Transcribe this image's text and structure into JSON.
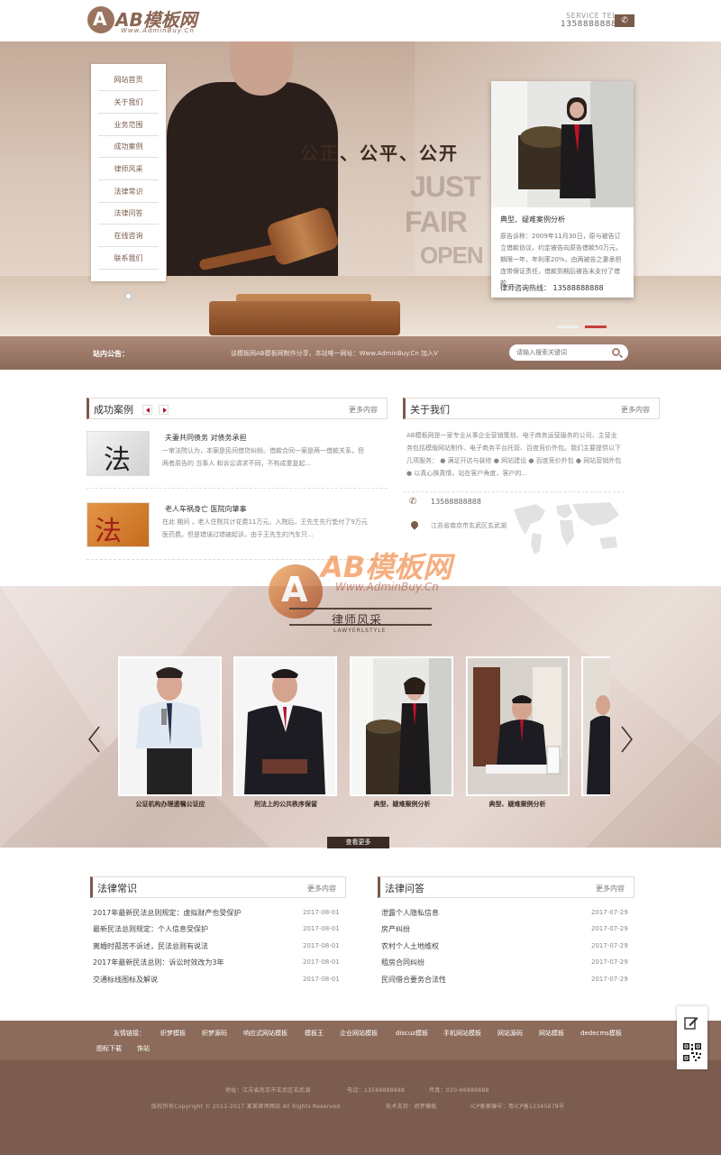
{
  "header": {
    "logo_text": "AB模板网",
    "logo_sub": "Www.AdminBuy.Cn",
    "service_label": "SERVICE TEL",
    "service_phone": "13588888888"
  },
  "nav": {
    "items": [
      "网站首页",
      "关于我们",
      "业务范围",
      "成功案例",
      "律师风采",
      "法律常识",
      "法律问答",
      "在线咨询",
      "联系我们"
    ]
  },
  "banner": {
    "slogan": "公正、公平、公开",
    "just": "JUST",
    "fair": "FAIR",
    "open": "OPEN",
    "case_title": "典型、疑难案例分析",
    "case_text": "原告诉称：2009年11月30日，原与被告订立借款协议，约定被告向原告借款50万元，期限一年，年利率20%，由两被告之妻承担连带保证责任，借款到期后被告未支付了借款...",
    "case_hotline": "律师咨询热线：  13588888888"
  },
  "notice": {
    "label": "站内公告：",
    "text": "谈模板网AB模板网制作分享，本站唯一网址：Www.AdminBuy.Cn 加入V",
    "search_placeholder": "请输入搜索关键词"
  },
  "cases": {
    "title": "成功案例",
    "more": "更多内容",
    "items": [
      {
        "title": "夫妻共同债务 对债务承担",
        "text": "一审法院认为，本案是民间借贷纠纷。借款合同一案是两一借款关系，但两者原告的 当事人 和诉讼请求不同，不构成重复起..."
      },
      {
        "title": "老人车祸身亡 医院向肇事",
        "text": "在此 期间 ，老人住院共计花费11万元。入院后，王先生先行垫付了9万元医药费。但是错误过错被起诉，由于王先生的汽车只..."
      }
    ]
  },
  "about": {
    "title": "关于我们",
    "more": "更多内容",
    "text": "AB模板网是一家专业从事企业营销策划、电子商务运营服务的公司，主营业务包括模版网站制作、电子商务平台托管、百度竞价外包。我们主要提供以下几项服务： ● 满足开店与装修 ● 网站建设 ● 百度竞价外包 ● 网站营销外包 ● 以真心换真情，站在客户角度，客户的...",
    "phone": "13588888888",
    "address": "江苏省南京市玄武区玄武湖"
  },
  "lawyers": {
    "watermark_text": "AB模板网",
    "watermark_sub": "Www.AdminBuy.Cn",
    "title": "律师风采",
    "subtitle": "LAWYERLSTYLE",
    "captions": [
      "公证机构办理遗嘱公证应",
      "刑法上的公共秩序保留",
      "典型、疑难案例分析",
      "典型、疑难案例分析"
    ],
    "view_more": "查看更多"
  },
  "knowledge": {
    "title": "法律常识",
    "more": "更多内容",
    "items": [
      {
        "title": "2017年最新民法总则规定：虚拟财产也受保护",
        "date": "2017-08-01"
      },
      {
        "title": "最新民法总则规定：个人信息受保护",
        "date": "2017-08-01"
      },
      {
        "title": "离婚时孤苦不诉述，民法总则有说法",
        "date": "2017-08-01"
      },
      {
        "title": "2017年最新民法总则：诉讼时效改为3年",
        "date": "2017-08-01"
      },
      {
        "title": "交通标线图标及解说",
        "date": "2017-08-01"
      }
    ]
  },
  "qa": {
    "title": "法律问答",
    "more": "更多内容",
    "items": [
      {
        "title": "泄露个人隐私信息",
        "date": "2017-07-29"
      },
      {
        "title": "房产纠纷",
        "date": "2017-07-29"
      },
      {
        "title": "农村个人土地维权",
        "date": "2017-07-29"
      },
      {
        "title": "租房合同纠纷",
        "date": "2017-07-29"
      },
      {
        "title": "民间借合要务合法性",
        "date": "2017-07-29"
      }
    ]
  },
  "links": {
    "label": "友情链接：",
    "items": [
      "织梦模板",
      "织梦源码",
      "响应式网站模板",
      "模板王",
      "企业网站模板",
      "discuz模板",
      "手机网站模板",
      "网站源码",
      "网站模板",
      "dedecms模板",
      "图标下载",
      "饰站"
    ]
  },
  "footer": {
    "address": "地址：江苏省南京市玄武区玄武湖",
    "phone": "电话：13588888888",
    "fax": "传真：020-66889888",
    "copyright": "版权所有Copyright © 2011-2017 某某律师网站 All Rights Reserved",
    "support": "技术支持：织梦模板",
    "icp": "ICP备案编号：粤ICP备12345678号"
  },
  "colors": {
    "brand_brown": "#8c6b5b",
    "dark_brown": "#7c5c4e",
    "accent_red": "#b3132d"
  }
}
